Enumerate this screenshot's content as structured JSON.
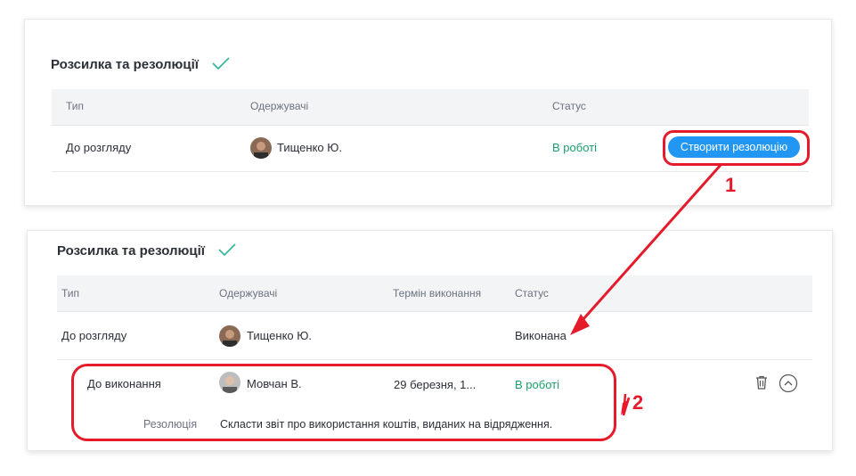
{
  "colors": {
    "accent": "#2196f3",
    "status_green": "#18a06b",
    "annotation_red": "#e51b2b",
    "check_green": "#2bb59b"
  },
  "top_panel": {
    "title": "Розсилка та резолюції",
    "headers": {
      "type": "Тип",
      "recipients": "Одержувачі",
      "status": "Статус"
    },
    "row": {
      "type": "До розгляду",
      "recipient": "Тищенко Ю.",
      "status": "В роботі",
      "action": "Створити резолюцію"
    }
  },
  "bottom_panel": {
    "title": "Розсилка та резолюції",
    "headers": {
      "type": "Тип",
      "recipients": "Одержувачі",
      "deadline": "Термін виконання",
      "status": "Статус"
    },
    "row1": {
      "type": "До розгляду",
      "recipient": "Тищенко Ю.",
      "status": "Виконана"
    },
    "row2": {
      "type": "До виконання",
      "recipient": "Мовчан В.",
      "deadline": "29 березня, 1...",
      "status": "В роботі"
    },
    "resolution": {
      "label": "Резолюція",
      "text": "Скласти звіт про використання коштів, виданих на відрядження."
    }
  },
  "annotations": {
    "step1": "1",
    "step2": "2"
  },
  "icons": {
    "check": "check-icon",
    "delete": "trash-icon",
    "collapse": "chevron-up-icon"
  }
}
